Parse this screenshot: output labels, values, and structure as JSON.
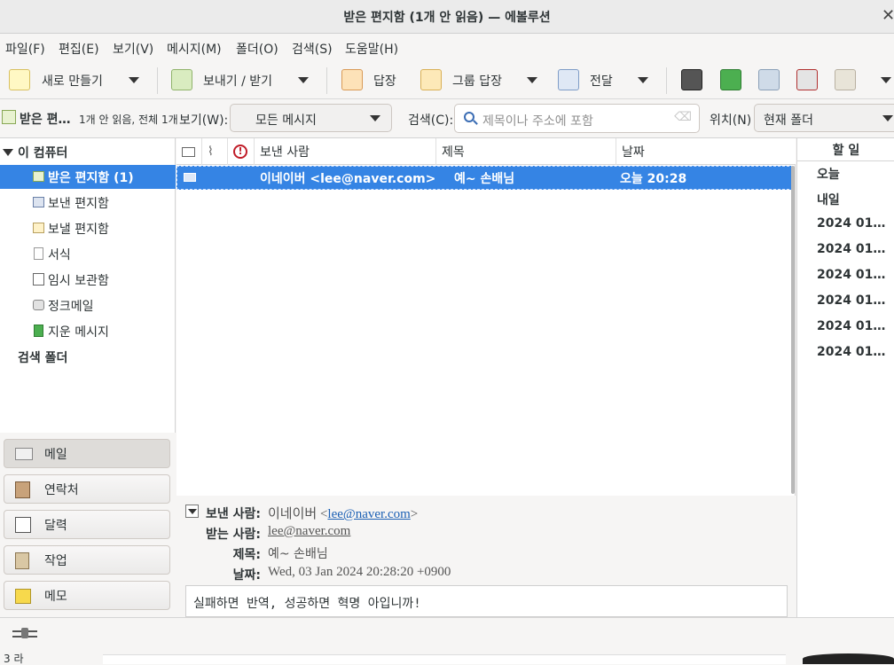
{
  "window": {
    "title": "받은 편지함 (1개 안 읽음) — 에볼루션"
  },
  "menu": [
    "파일(F)",
    "편집(E)",
    "보기(V)",
    "메시지(M)",
    "폴더(O)",
    "검색(S)",
    "도움말(H)"
  ],
  "toolbar": {
    "new_label": "새로 만들기",
    "send_receive_label": "보내기 / 받기",
    "reply_label": "답장",
    "reply_group_label": "그룹 답장",
    "forward_label": "전달"
  },
  "filterbar": {
    "folder_name": "받은 편…",
    "folder_counts": "1개 안 읽음, 전체 1개",
    "view_label": "보기(W):",
    "view_value": "모든 메시지",
    "search_label": "검색(C):",
    "search_placeholder": "제목이나 주소에 포함",
    "location_label": "위치(N)",
    "location_value": "현재 폴더"
  },
  "sidebar": {
    "root": "이 컴퓨터",
    "folders": [
      "받은 편지함 (1)",
      "보낸 편지함",
      "보낼 편지함",
      "서식",
      "임시 보관함",
      "정크메일",
      "지운 메시지"
    ],
    "search_folders": "검색 폴더"
  },
  "switcher": [
    "메일",
    "연락처",
    "달력",
    "작업",
    "메모"
  ],
  "message_list": {
    "columns": [
      "보낸 사람",
      "제목",
      "날짜"
    ],
    "rows": [
      {
        "from": "이네이버 <lee@naver.com>",
        "subject": "예~ 손배님",
        "date": "오늘 20:28"
      }
    ]
  },
  "preview": {
    "from_label": "보낸 사람:",
    "from_name": "이네이버 <",
    "from_email": "lee@naver.com",
    "from_close": ">",
    "to_label": "받는 사람:",
    "to_email": "lee@naver.com",
    "subject_label": "제목:",
    "subject": "예~ 손배님",
    "date_label": "날짜:",
    "date": "Wed, 03 Jan 2024 20:28:20 +0900",
    "body": "실패하면 반역, 성공하면 혁명 아입니까!"
  },
  "todo": {
    "header": "할 일",
    "items": [
      "오늘",
      "내일",
      "2024 01…",
      "2024 01…",
      "2024 01…",
      "2024 01…",
      "2024 01…",
      "2024 01…"
    ]
  },
  "bottom": {
    "partial_text": "3 라"
  },
  "colors": {
    "accent": "#3584e4",
    "link": "#1a5fb4"
  }
}
